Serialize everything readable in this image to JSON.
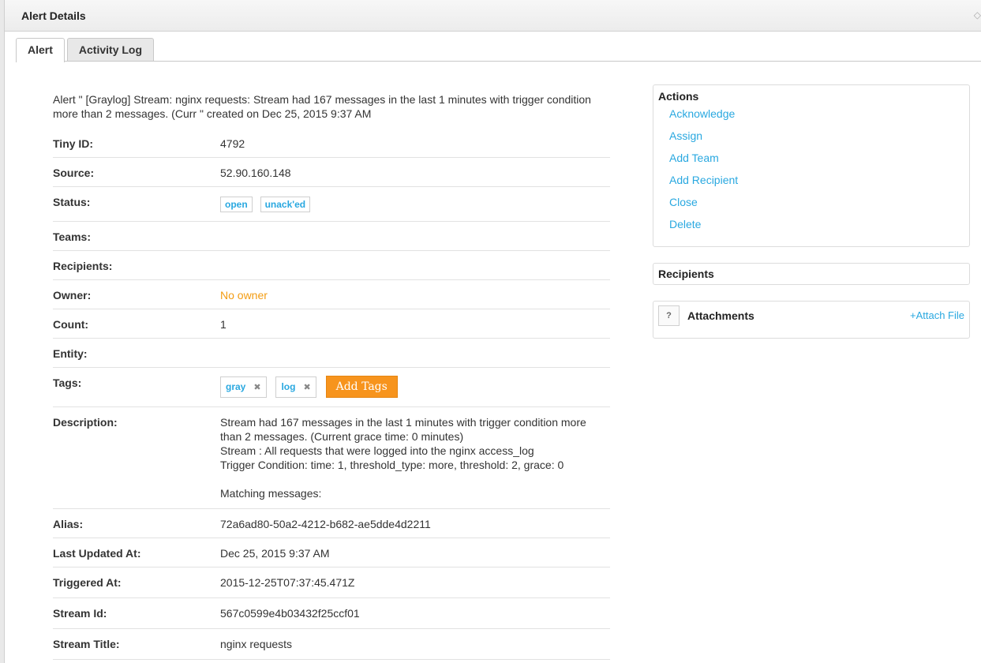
{
  "window": {
    "title": "Alert Details"
  },
  "tabs": [
    {
      "label": "Alert"
    },
    {
      "label": "Activity Log"
    }
  ],
  "intro": "Alert \" [Graylog] Stream: nginx requests: Stream had 167 messages in the last 1 minutes with trigger condition more than 2 messages. (Curr \" created on Dec 25, 2015 9:37 AM",
  "details": {
    "tiny_id": {
      "label": "Tiny ID:",
      "value": "4792"
    },
    "source": {
      "label": "Source:",
      "value": "52.90.160.148"
    },
    "status": {
      "label": "Status:",
      "badges": [
        "open",
        "unack'ed"
      ]
    },
    "teams": {
      "label": "Teams:",
      "value": ""
    },
    "recipients": {
      "label": "Recipients:",
      "value": ""
    },
    "owner": {
      "label": "Owner:",
      "value": "No owner"
    },
    "count": {
      "label": "Count:",
      "value": "1"
    },
    "entity": {
      "label": "Entity:",
      "value": ""
    },
    "tags": {
      "label": "Tags:",
      "items": [
        "gray",
        "log"
      ],
      "remove_glyph": "✖",
      "add_label": "Add Tags"
    },
    "description": {
      "label": "Description:",
      "lines": [
        "Stream had 167 messages in the last 1 minutes with trigger condition more than 2 messages. (Current grace time: 0 minutes)",
        "Stream : All requests that were logged into the nginx access_log",
        "Trigger Condition: time: 1, threshold_type: more, threshold: 2, grace: 0",
        "",
        "Matching messages:"
      ]
    },
    "alias": {
      "label": "Alias:",
      "value": "72a6ad80-50a2-4212-b682-ae5dde4d2211"
    },
    "last_updated": {
      "label": "Last Updated At:",
      "value": "Dec 25, 2015 9:37 AM"
    },
    "triggered": {
      "label": "Triggered At:",
      "value": "2015-12-25T07:37:45.471Z"
    },
    "stream_id": {
      "label": "Stream Id:",
      "value": "567c0599e4b03432f25ccf01"
    },
    "stream_title": {
      "label": "Stream Title:",
      "value": "nginx requests"
    }
  },
  "actions": {
    "title": "Actions",
    "items": [
      "Acknowledge",
      "Assign",
      "Add Team",
      "Add Recipient",
      "Close",
      "Delete"
    ]
  },
  "recipients_panel": {
    "title": "Recipients"
  },
  "attachments_panel": {
    "title": "Attachments",
    "icon_text": "?",
    "link": "+Attach File"
  },
  "colors": {
    "link": "#29a8e0",
    "owner": "#f39c12",
    "add_tags_bg": "#f7941d"
  }
}
